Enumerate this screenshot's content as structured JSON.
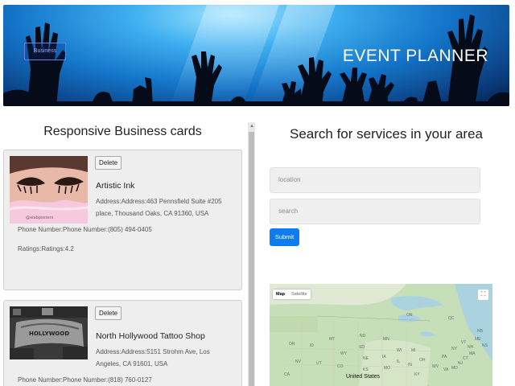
{
  "header": {
    "title": "EVENT PLANNER",
    "nav_button": "Business"
  },
  "left": {
    "title": "Responsive Business cards",
    "cards": [
      {
        "delete_label": "Delete",
        "name": "Artistic Ink",
        "address": "Address:Address:463 Pennsfield Suite #205 place, Thousand Oaks, CA 91360, USA",
        "phone": "Phone Number:Phone Number:(805) 494-0405",
        "ratings": "Ratings:Ratings:4.2",
        "photo_caption": "@alabposters"
      },
      {
        "delete_label": "Delete",
        "name": "North Hollywood Tattoo Shop",
        "address": "Address:Address:5151 Strohm Ave, Los Angeles, CA 91601, USA",
        "phone": "Phone Number:Phone Number:(818) 760-0127",
        "photo_caption": "HOLLYWOOD"
      }
    ]
  },
  "right": {
    "title": "Search for services in your area",
    "location_placeholder": "location",
    "search_placeholder": "search",
    "submit_label": "Submit",
    "map": {
      "map_tab": "Map",
      "satellite_tab": "Satellite",
      "country_label": "United States",
      "state_labels": [
        "MT",
        "ND",
        "MN",
        "WI",
        "SD",
        "NE",
        "IA",
        "IL",
        "WY",
        "OR",
        "ID",
        "NV",
        "UT",
        "CO",
        "KS",
        "MO",
        "IN",
        "OH",
        "KY",
        "PA",
        "NY",
        "VA",
        "WV",
        "MI",
        "ON",
        "QC",
        "ME",
        "VT",
        "NH",
        "NB",
        "NS",
        "CA",
        "MA",
        "CT",
        "NJ",
        "MD"
      ]
    }
  },
  "colors": {
    "accent": "#0d7cf2",
    "card_bg": "#eeeeee"
  }
}
